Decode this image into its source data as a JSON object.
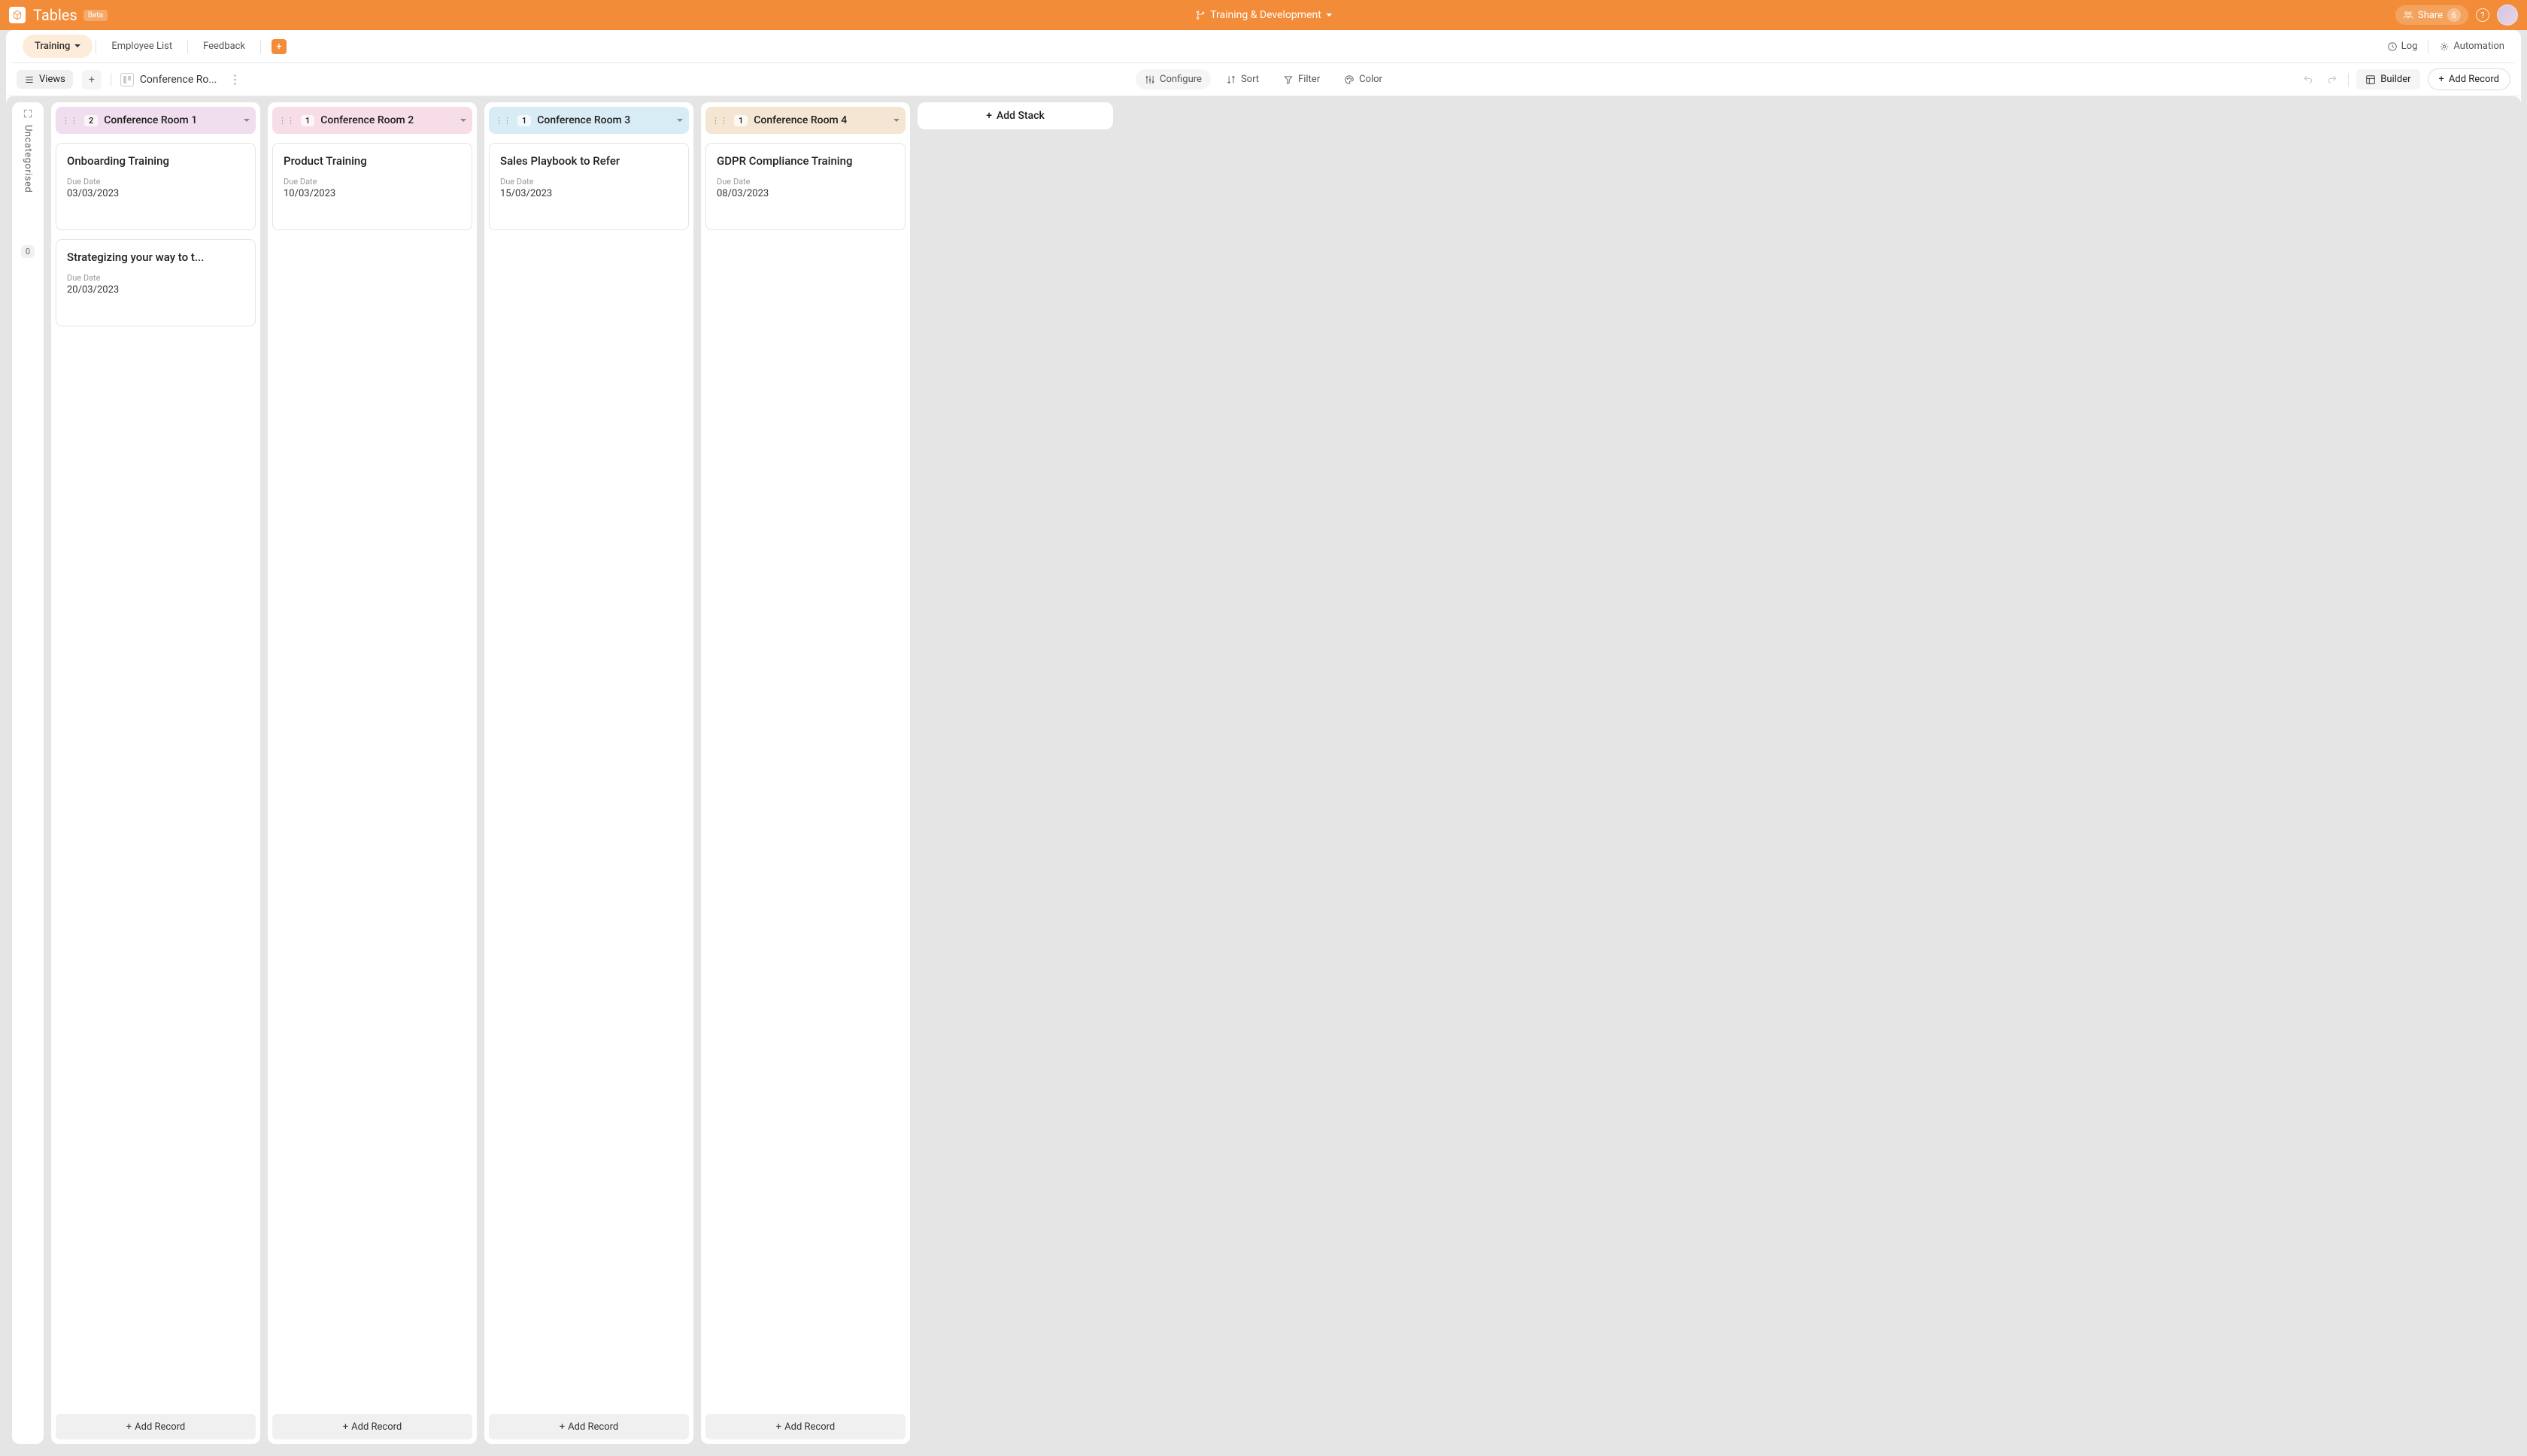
{
  "header": {
    "app_title": "Tables",
    "beta_label": "Beta",
    "project_name": "Training & Development",
    "share_label": "Share",
    "share_count": "6",
    "help_label": "?"
  },
  "tabs": {
    "active": "Training",
    "items": [
      "Training",
      "Employee List",
      "Feedback"
    ],
    "log_label": "Log",
    "automation_label": "Automation"
  },
  "toolbar": {
    "views_label": "Views",
    "view_name": "Conference Ro...",
    "configure": "Configure",
    "sort": "Sort",
    "filter": "Filter",
    "color": "Color",
    "builder": "Builder",
    "add_record": "Add Record"
  },
  "uncategorised": {
    "label": "Uncategorised",
    "count": "0"
  },
  "add_stack_label": "Add Stack",
  "add_record_label": "Add Record",
  "due_date_label": "Due Date",
  "stacks": [
    {
      "name": "Conference Room 1",
      "count": "2",
      "color": "c1",
      "cards": [
        {
          "title": "Onboarding Training",
          "due_date": "03/03/2023"
        },
        {
          "title": "Strategizing your way to t...",
          "due_date": "20/03/2023"
        }
      ]
    },
    {
      "name": "Conference Room 2",
      "count": "1",
      "color": "c2",
      "cards": [
        {
          "title": "Product Training",
          "due_date": "10/03/2023"
        }
      ]
    },
    {
      "name": "Conference Room 3",
      "count": "1",
      "color": "c3",
      "cards": [
        {
          "title": "Sales Playbook to Refer",
          "due_date": "15/03/2023"
        }
      ]
    },
    {
      "name": "Conference Room 4",
      "count": "1",
      "color": "c4",
      "cards": [
        {
          "title": "GDPR Compliance Training",
          "due_date": "08/03/2023"
        }
      ]
    }
  ]
}
